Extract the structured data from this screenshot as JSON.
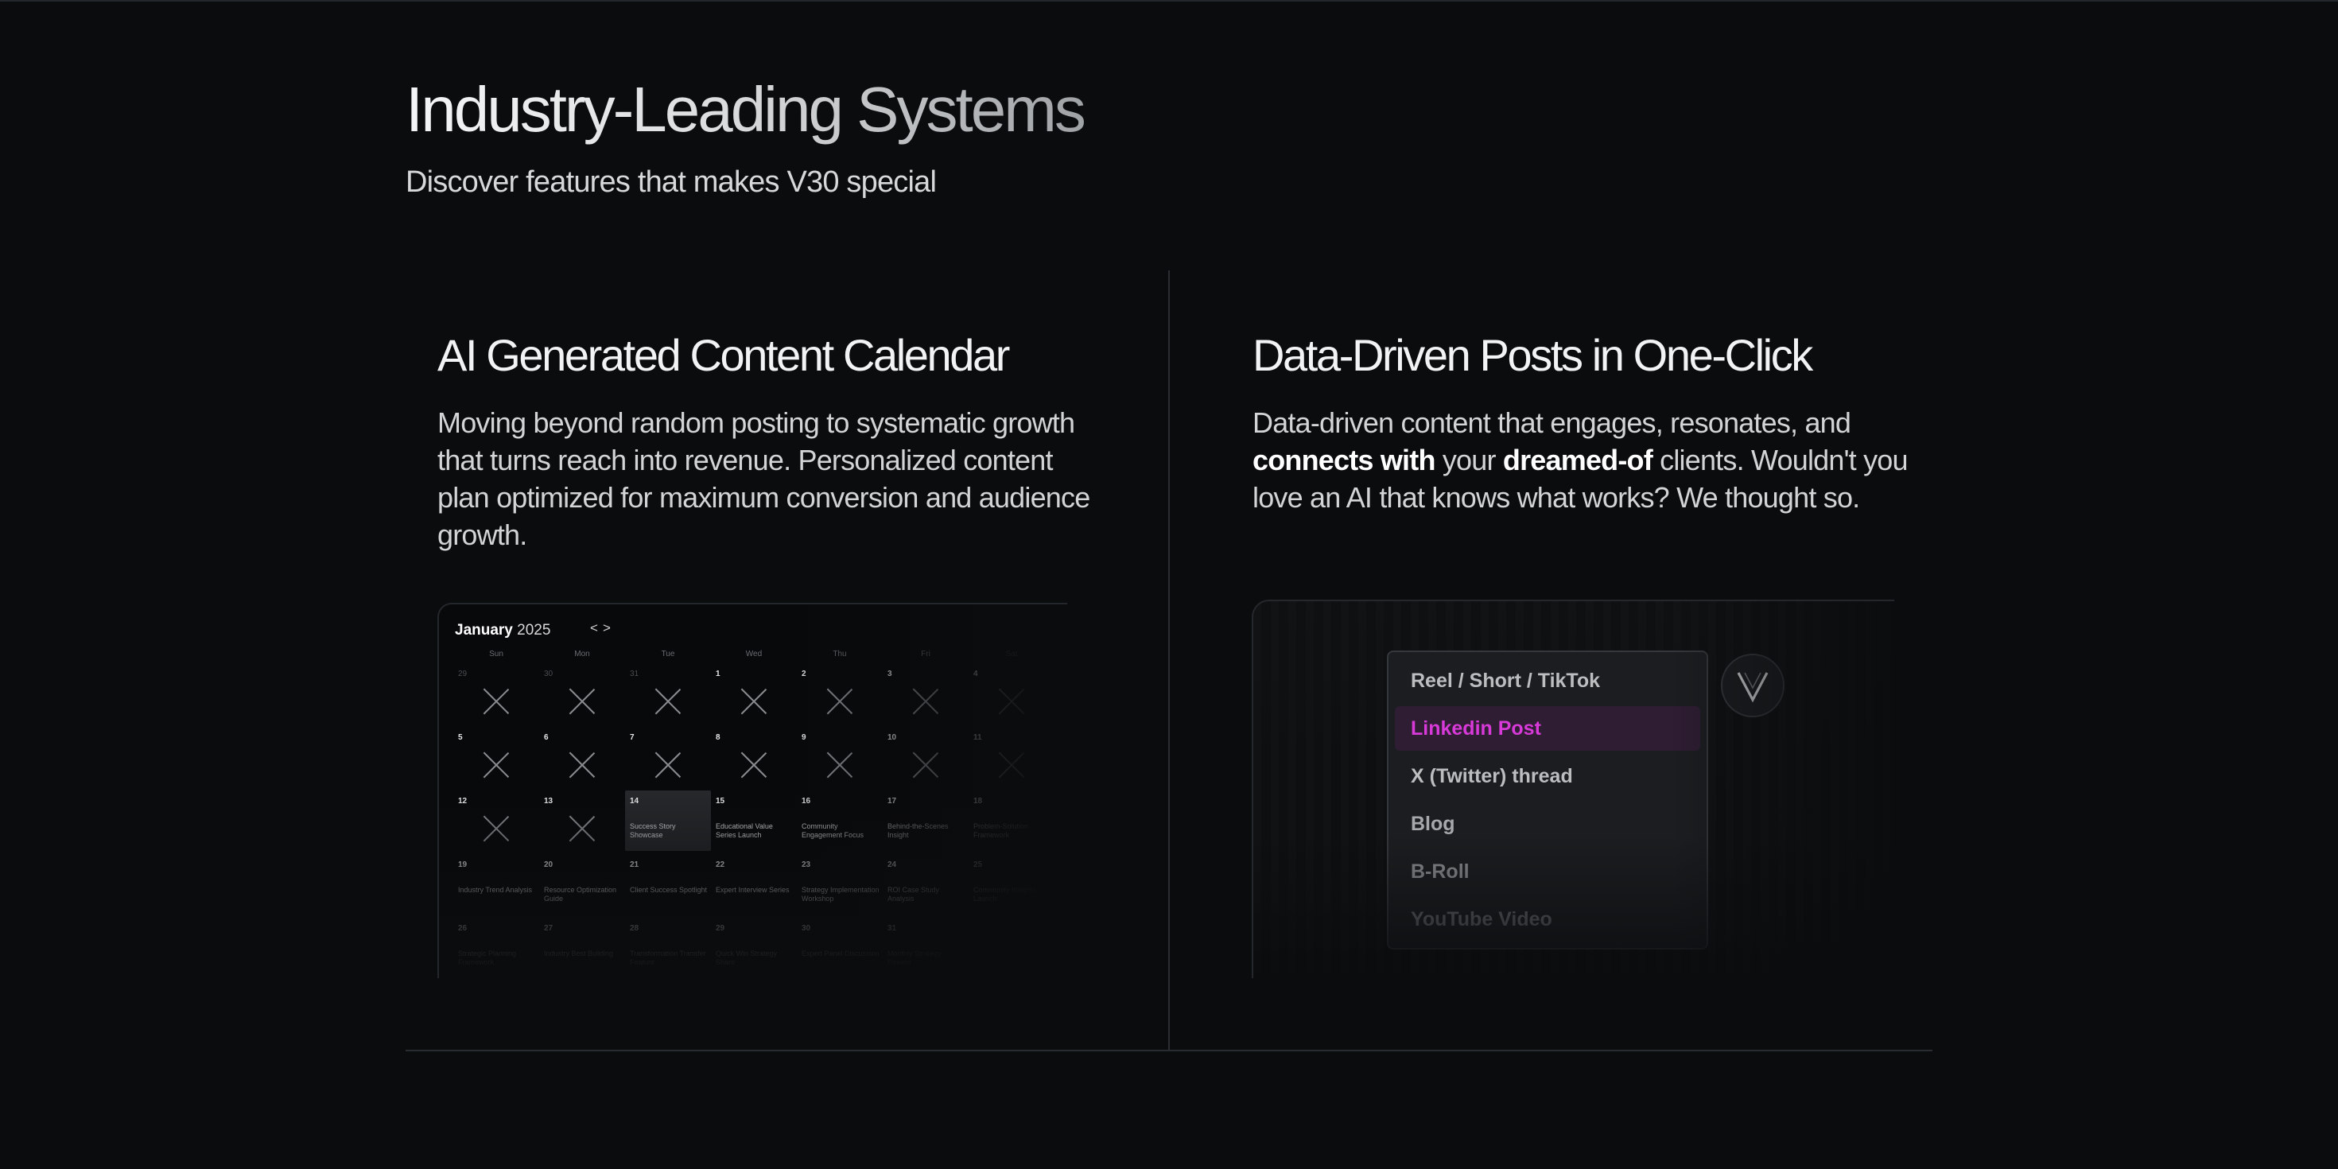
{
  "hero": {
    "title": "Industry-Leading Systems",
    "subtitle": "Discover features that makes V30 special"
  },
  "feature_calendar": {
    "title": "AI Generated Content Calendar",
    "description": "Moving beyond random posting to systematic growth that turns reach into revenue. Personalized content plan optimized for maximum conversion and audience growth.",
    "calendar": {
      "month": "January",
      "year": "2025",
      "prev_icon": "<",
      "next_icon": ">",
      "weekdays": [
        "Sun",
        "Mon",
        "Tue",
        "Wed",
        "Thu",
        "Fri",
        "Sat"
      ],
      "weeks": [
        [
          {
            "d": "29",
            "dim": true,
            "x": true
          },
          {
            "d": "30",
            "dim": true,
            "x": true
          },
          {
            "d": "31",
            "dim": true,
            "x": true
          },
          {
            "d": "1",
            "x": true
          },
          {
            "d": "2",
            "x": true
          },
          {
            "d": "3",
            "x": true
          },
          {
            "d": "4",
            "x": true
          }
        ],
        [
          {
            "d": "5",
            "x": true
          },
          {
            "d": "6",
            "x": true
          },
          {
            "d": "7",
            "x": true
          },
          {
            "d": "8",
            "x": true
          },
          {
            "d": "9",
            "x": true
          },
          {
            "d": "10",
            "x": true
          },
          {
            "d": "11",
            "x": true
          }
        ],
        [
          {
            "d": "12",
            "x": true
          },
          {
            "d": "13",
            "x": true
          },
          {
            "d": "14",
            "e": "Success Story Showcase",
            "hl": true
          },
          {
            "d": "15",
            "e": "Educational Value Series Launch"
          },
          {
            "d": "16",
            "e": "Community Engagement Focus"
          },
          {
            "d": "17",
            "e": "Behind-the-Scenes Insight"
          },
          {
            "d": "18",
            "e": "Problem-Solution Framework"
          }
        ],
        [
          {
            "d": "19",
            "e": "Industry Trend Analysis"
          },
          {
            "d": "20",
            "e": "Resource Optimization Guide"
          },
          {
            "d": "21",
            "e": "Client Success Spotlight"
          },
          {
            "d": "22",
            "e": "Expert Interview Series"
          },
          {
            "d": "23",
            "e": "Strategy Implementation Workshop"
          },
          {
            "d": "24",
            "e": "ROI Case Study Analysis"
          },
          {
            "d": "25",
            "e": "Community Insights Launch"
          }
        ],
        [
          {
            "d": "26",
            "e": "Strategic Planning Framework"
          },
          {
            "d": "27",
            "e": "Industry Best Building"
          },
          {
            "d": "28",
            "e": "Transformation Transfer Feature"
          },
          {
            "d": "29",
            "e": "Quick Win Strategy Share"
          },
          {
            "d": "30",
            "e": "Expert Panel Discussion"
          },
          {
            "d": "31",
            "e": "Monthly Strategy Review"
          },
          {
            "d": "",
            "e": ""
          }
        ]
      ]
    }
  },
  "feature_posts": {
    "title": "Data-Driven Posts in One-Click",
    "description_parts": [
      {
        "t": "Data-driven content that engages, resonates, and ",
        "b": false
      },
      {
        "t": "connects with",
        "b": true
      },
      {
        "t": " your ",
        "b": false
      },
      {
        "t": "dreamed-of",
        "b": true
      },
      {
        "t": " clients. Wouldn't you love an AI that knows what works? We thought so.",
        "b": false
      }
    ],
    "options": [
      "Reel / Short / TikTok",
      "Linkedin Post",
      "X (Twitter) thread",
      "Blog",
      "B-Roll",
      "YouTube Video"
    ],
    "selected_index": 1,
    "badge_icon": "v30-logo-icon",
    "accent_color": "#d83ad9"
  }
}
